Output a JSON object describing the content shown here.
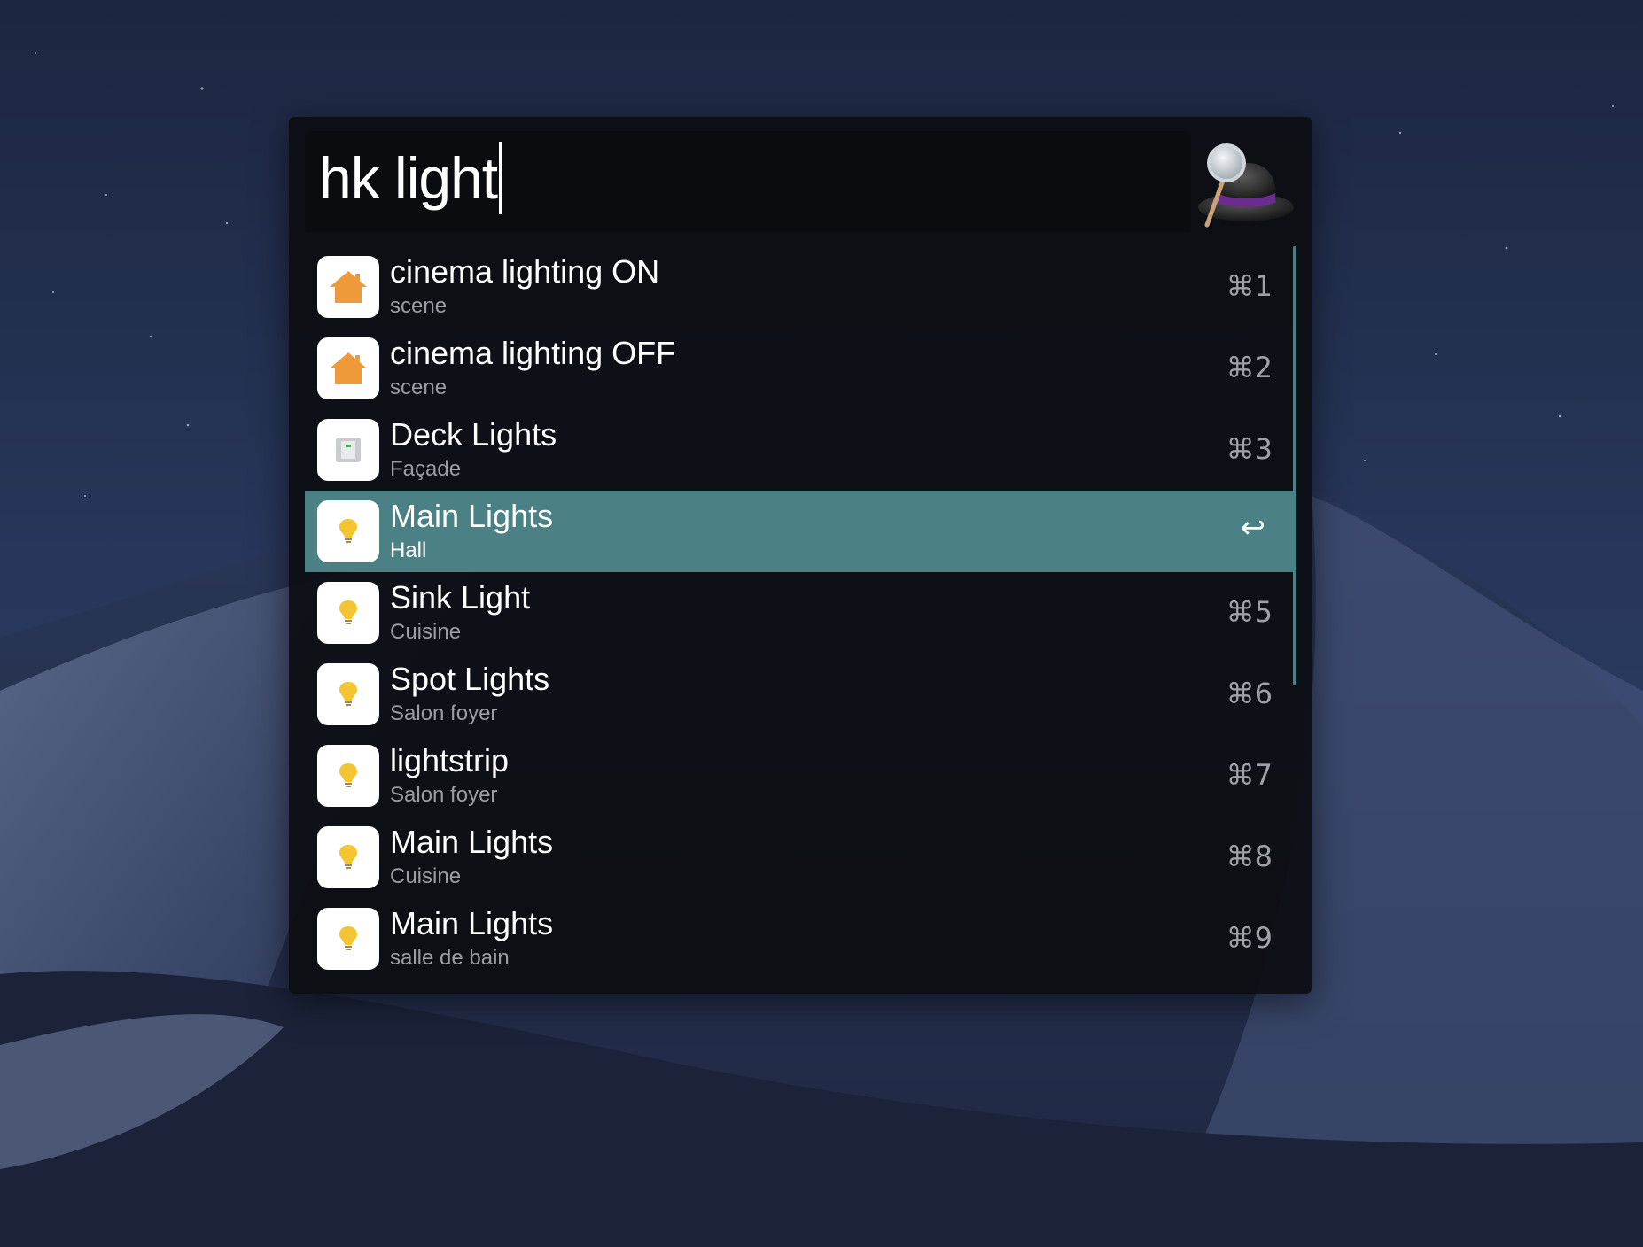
{
  "search": {
    "query": "hk light"
  },
  "results": [
    {
      "title": "cinema lighting ON",
      "subtitle": "scene",
      "shortcut": "⌘1",
      "icon": "home-icon",
      "selected": false
    },
    {
      "title": "cinema lighting OFF",
      "subtitle": "scene",
      "shortcut": "⌘2",
      "icon": "home-icon",
      "selected": false
    },
    {
      "title": "Deck Lights",
      "subtitle": "Façade",
      "shortcut": "⌘3",
      "icon": "switch-icon",
      "selected": false
    },
    {
      "title": "Main Lights",
      "subtitle": "Hall",
      "shortcut": "↩",
      "icon": "lightbulb-icon",
      "selected": true
    },
    {
      "title": "Sink Light",
      "subtitle": "Cuisine",
      "shortcut": "⌘5",
      "icon": "lightbulb-icon",
      "selected": false
    },
    {
      "title": "Spot Lights",
      "subtitle": "Salon foyer",
      "shortcut": "⌘6",
      "icon": "lightbulb-icon",
      "selected": false
    },
    {
      "title": "lightstrip",
      "subtitle": "Salon foyer",
      "shortcut": "⌘7",
      "icon": "lightbulb-icon",
      "selected": false
    },
    {
      "title": "Main Lights",
      "subtitle": "Cuisine",
      "shortcut": "⌘8",
      "icon": "lightbulb-icon",
      "selected": false
    },
    {
      "title": "Main Lights",
      "subtitle": "salle de bain",
      "shortcut": "⌘9",
      "icon": "lightbulb-icon",
      "selected": false
    }
  ],
  "colors": {
    "selection": "#4b8184",
    "home_icon": "#ef9a3a",
    "bulb_icon": "#f5c431",
    "switch_indicator": "#4caf50"
  }
}
